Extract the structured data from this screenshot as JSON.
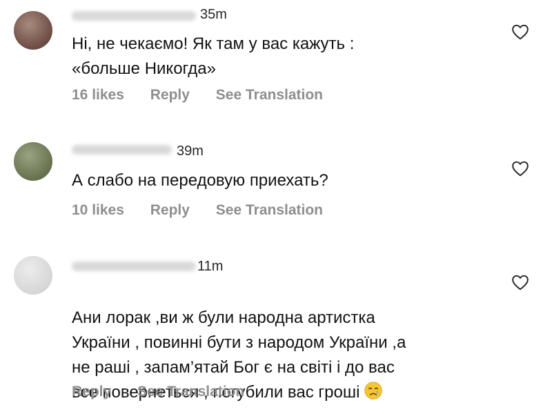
{
  "comments": [
    {
      "time": "35m",
      "text": "Ні, не чекаємо! Як там у вас кажуть :\n«больше Никогда»",
      "likes": "16 likes",
      "reply": "Reply",
      "see_translation": "See Translation",
      "avatar_color": "#7a5a4e"
    },
    {
      "time": "39m",
      "text": "А слабо на передовую приехать?",
      "likes": "10 likes",
      "reply": "Reply",
      "see_translation": "See Translation",
      "avatar_color": "#6f7a58"
    },
    {
      "time": "11m",
      "text": "Ани лорак ,ви ж були народна артистка\nУкраїни , повинні бути з народом України ,а\nне раші , запам’ятай Бог є на світі і до вас\nвсе повернеться , погубили вас гроші",
      "reply": "Reply",
      "see_translation": "See Translation",
      "emoji": "crying-face",
      "avatar_color": "#d8d8d8"
    }
  ],
  "colors": {
    "text": "#111111",
    "meta": "#8e8e8e",
    "heart": "#262626"
  },
  "icons": {
    "like": "heart-outline-icon",
    "emoji": "crying-face-emoji"
  }
}
